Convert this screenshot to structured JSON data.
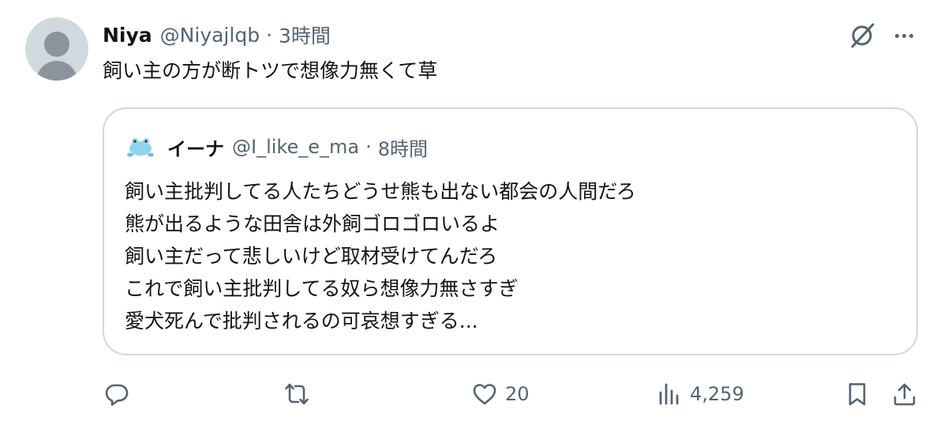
{
  "post": {
    "author_name": "Niya",
    "author_handle": "@Niyajlqb",
    "separator": "·",
    "time": "3時間",
    "text": "飼い主の方が断トツで想像力無くて草"
  },
  "quoted_post": {
    "author_name": "イーナ",
    "author_handle": "@I_like_e_ma",
    "separator": "·",
    "time": "8時間",
    "lines": [
      "飼い主批判してる人たちどうせ熊も出ない都会の人間だろ",
      "熊が出るような田舎は外飼ゴロゴロいるよ",
      "飼い主だって悲しいけど取材受けてんだろ",
      "これで飼い主批判してる奴ら想像力無さすぎ",
      "愛犬死んで批判されるの可哀想すぎる..."
    ]
  },
  "actions": {
    "reply_icon": "reply-icon",
    "retweet_icon": "retweet-icon",
    "like_icon": "heart-icon",
    "like_count": "20",
    "views_icon": "views-chart-icon",
    "views_count": "4,259",
    "bookmark_icon": "bookmark-icon",
    "share_icon": "share-icon"
  },
  "colors": {
    "text_primary": "#0f1419",
    "text_secondary": "#536471",
    "border": "#cfd9de",
    "avatar_bg": "#cfd9de"
  }
}
